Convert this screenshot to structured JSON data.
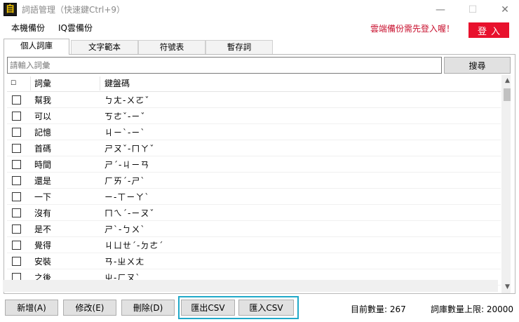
{
  "window": {
    "title": "詞語管理（快速鍵Ctrl+9）",
    "minimize": "—",
    "maximize": "☐",
    "close": "✕"
  },
  "menu": {
    "local_backup": "本機備份",
    "cloud_backup": "IQ雲備份",
    "cloud_notice": "雲端備份需先登入喔！",
    "login": "登入"
  },
  "tabs": [
    "個人詞庫",
    "文字範本",
    "符號表",
    "暫存詞"
  ],
  "active_tab": 0,
  "search": {
    "placeholder": "請輸入詞彙",
    "button": "搜尋"
  },
  "table": {
    "header_check": "☐",
    "columns": [
      "詞彙",
      "鍵盤碼"
    ],
    "rows": [
      {
        "word": "幫我",
        "code": "ㄅㄤ-ㄨㄛˇ"
      },
      {
        "word": "可以",
        "code": "ㄎㄜˇ-ㄧˇ"
      },
      {
        "word": "記憶",
        "code": "ㄐㄧˋ-ㄧˋ"
      },
      {
        "word": "首碼",
        "code": "ㄕㄡˇ-ㄇㄚˇ"
      },
      {
        "word": "時間",
        "code": "ㄕˊ-ㄐㄧㄢ"
      },
      {
        "word": "還是",
        "code": "ㄏㄞˊ-ㄕˋ"
      },
      {
        "word": "一下",
        "code": "ㄧ-ㄒㄧㄚˋ"
      },
      {
        "word": "沒有",
        "code": "ㄇㄟˊ-ㄧㄡˇ"
      },
      {
        "word": "是不",
        "code": "ㄕˋ-ㄅㄨˋ"
      },
      {
        "word": "覺得",
        "code": "ㄐㄩㄝˊ-ㄉㄜˊ"
      },
      {
        "word": "安裝",
        "code": "ㄢ-ㄓㄨㄤ"
      },
      {
        "word": "之後",
        "code": "ㄓ-ㄏㄡˋ"
      }
    ]
  },
  "scrollbar": {
    "up": "▲",
    "down": "▼"
  },
  "buttons": {
    "add": "新增(A)",
    "edit": "修改(E)",
    "delete": "刪除(D)",
    "export_csv": "匯出CSV",
    "import_csv": "匯入CSV"
  },
  "status": {
    "current_count": "目前數量: 267",
    "limit": "詞庫數量上限: 20000"
  }
}
